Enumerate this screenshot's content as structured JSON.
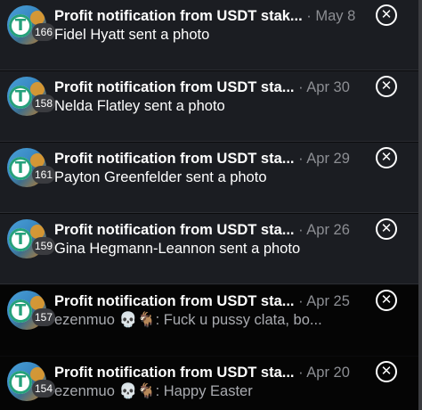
{
  "notifications": [
    {
      "title": "Profit notification from USDT stak...",
      "date": "May 8",
      "badge": "166",
      "text": "Fidel Hyatt sent a photo",
      "emoji": ""
    },
    {
      "title": "Profit notification from USDT sta...",
      "date": "Apr 30",
      "badge": "158",
      "text": "Nelda Flatley sent a photo",
      "emoji": ""
    },
    {
      "title": "Profit notification from USDT sta...",
      "date": "Apr 29",
      "badge": "161",
      "text": "Payton Greenfelder sent a photo",
      "emoji": ""
    },
    {
      "title": "Profit notification from USDT sta...",
      "date": "Apr 26",
      "badge": "159",
      "text": "Gina Hegmann-Leannon sent a photo",
      "emoji": ""
    },
    {
      "title": "Profit notification from USDT sta...",
      "date": "Apr 25",
      "badge": "157",
      "sender": "ezenmuo",
      "emoji": "💀🐐",
      "text": ": Fuck u pussy clata, bo..."
    },
    {
      "title": "Profit notification from USDT sta...",
      "date": "Apr 20",
      "badge": "154",
      "sender": "ezenmuo",
      "emoji": "💀🐐",
      "text": ": Happy Easter"
    }
  ],
  "separator": "·",
  "coin_symbol": "T",
  "icons": {
    "close": "close-icon",
    "avatar": "usdt-avatar"
  },
  "colors": {
    "row_bg": "#1b1d22",
    "row_dark_bg": "#050505",
    "muted_text": "#8c8e93",
    "usdt_green": "#26a17b"
  }
}
